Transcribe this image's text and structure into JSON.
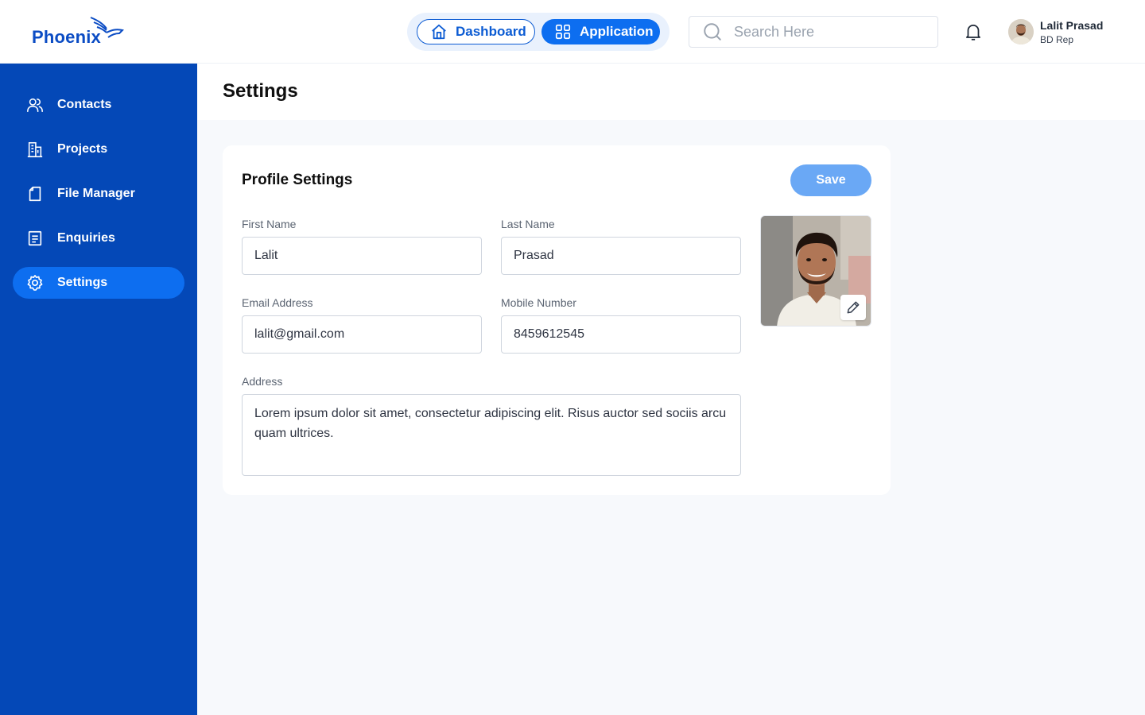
{
  "brand": {
    "name": "Phoenix"
  },
  "header": {
    "tabs": [
      {
        "label": "Dashboard",
        "icon": "home-icon"
      },
      {
        "label": "Application",
        "icon": "grid-icon"
      }
    ],
    "search": {
      "placeholder": "Search Here",
      "value": ""
    },
    "user": {
      "name": "Lalit Prasad",
      "role": "BD Rep"
    }
  },
  "sidebar": {
    "items": [
      {
        "label": "Contacts",
        "icon": "users-icon",
        "active": false
      },
      {
        "label": "Projects",
        "icon": "building-icon",
        "active": false
      },
      {
        "label": "File Manager",
        "icon": "file-icon",
        "active": false
      },
      {
        "label": "Enquiries",
        "icon": "document-icon",
        "active": false
      },
      {
        "label": "Settings",
        "icon": "gear-icon",
        "active": true
      }
    ]
  },
  "page": {
    "title": "Settings"
  },
  "profile": {
    "title": "Profile Settings",
    "save_label": "Save",
    "fields": {
      "first_name": {
        "label": "First Name",
        "value": "Lalit"
      },
      "last_name": {
        "label": "Last Name",
        "value": "Prasad"
      },
      "email": {
        "label": "Email Address",
        "value": "lalit@gmail.com"
      },
      "mobile": {
        "label": "Mobile Number",
        "value": "8459612545"
      },
      "address": {
        "label": "Address",
        "value": "Lorem ipsum dolor sit amet, consectetur adipiscing elit. Risus auctor sed sociis arcu quam ultrices."
      }
    }
  },
  "colors": {
    "sidebar": "#0448B7",
    "accent": "#0D6EF0",
    "save_button": "#6AA8F5",
    "page_background": "#F7F9FC"
  }
}
